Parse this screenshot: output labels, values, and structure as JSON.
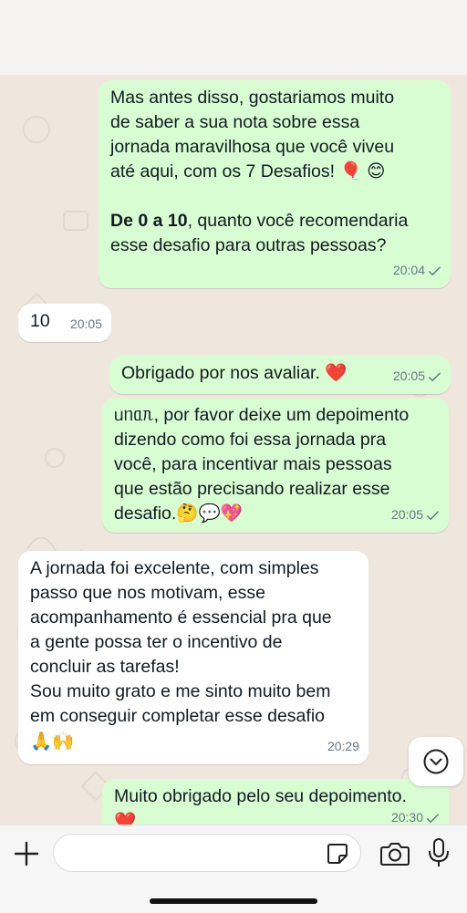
{
  "messages": [
    {
      "id": "m1",
      "dir": "out",
      "lines": [
        "Mas antes disso, gostariamos muito",
        "de saber a sua nota sobre essa",
        "jornada maravilhosa que você viveu",
        "até aqui, com os 7 Desafios! 🎈 😊",
        "",
        "De 0 a 10, quanto você recomendaria",
        "esse desafio para outras pessoas?"
      ],
      "bold_prefix": "De 0 a 10",
      "time": "20:04",
      "status": "sent"
    },
    {
      "id": "m2",
      "dir": "in",
      "text": "10",
      "time": "20:05"
    },
    {
      "id": "m3",
      "dir": "out",
      "text": "Obrigado por nos avaliar. ❤️",
      "time": "20:05",
      "status": "sent"
    },
    {
      "id": "m4",
      "dir": "out",
      "lines": [
        "ᥙᥒᥲᥰ, por favor deixe um depoimento",
        "dizendo como foi essa jornada pra",
        "você, para incentivar mais pessoas",
        "que estão precisando realizar esse",
        "desafio.🤔💬💖"
      ],
      "time": "20:05",
      "status": "sent"
    },
    {
      "id": "m5",
      "dir": "in",
      "lines": [
        "A jornada foi excelente, com simples",
        "passo que nos motivam, esse",
        "acompanhamento é essencial pra que",
        "a gente possa ter o incentivo de",
        "concluir as tarefas!",
        "Sou muito grato e me sinto muito bem",
        "em conseguir completar esse desafio",
        "🙏🙌"
      ],
      "time": "20:29"
    },
    {
      "id": "m6",
      "dir": "out",
      "lines": [
        "Muito obrigado pelo seu depoimento.",
        "❤️"
      ],
      "time": "20:30",
      "status": "sent"
    }
  ],
  "icons": {
    "scroll_down": "chevron-down-circle-icon",
    "attach": "plus-icon",
    "sticker": "sticker-icon",
    "camera": "camera-icon",
    "mic": "microphone-icon",
    "tick": "check-icon"
  },
  "composer": {
    "value": ""
  },
  "colors": {
    "outgoing_bubble": "#d9fdd3",
    "incoming_bubble": "#ffffff",
    "chat_background": "#efe7de",
    "meta_text": "#667781"
  }
}
